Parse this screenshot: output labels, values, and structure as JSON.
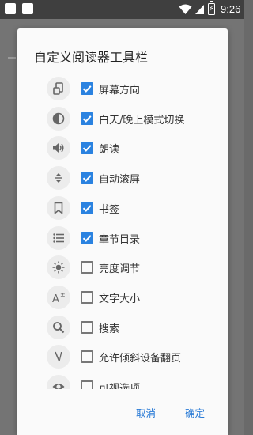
{
  "status_bar": {
    "time": "9:26",
    "battery_icon": "battery-charging-icon",
    "wifi_icon": "wifi-icon",
    "signal_icon": "signal-icon"
  },
  "dialog": {
    "title": "自定义阅读器工具栏",
    "items": [
      {
        "label": "屏幕方向",
        "checked": true,
        "icon": "screen-rotation-icon"
      },
      {
        "label": "白天/晚上模式切换",
        "checked": true,
        "icon": "day-night-icon"
      },
      {
        "label": "朗读",
        "checked": true,
        "icon": "speaker-icon"
      },
      {
        "label": "自动滚屏",
        "checked": true,
        "icon": "auto-scroll-icon"
      },
      {
        "label": "书签",
        "checked": true,
        "icon": "bookmark-icon"
      },
      {
        "label": "章节目录",
        "checked": true,
        "icon": "toc-list-icon"
      },
      {
        "label": "亮度调节",
        "checked": false,
        "icon": "brightness-icon"
      },
      {
        "label": "文字大小",
        "checked": false,
        "icon": "font-size-icon"
      },
      {
        "label": "搜索",
        "checked": false,
        "icon": "search-icon"
      },
      {
        "label": "允许倾斜设备翻页",
        "checked": false,
        "icon": "tilt-page-icon"
      },
      {
        "label": "可视选项",
        "checked": false,
        "icon": "eye-icon"
      }
    ],
    "cancel_label": "取消",
    "ok_label": "确定"
  },
  "colors": {
    "accent": "#2a82e0",
    "button_text": "#2a7bd6",
    "dim_background": "#747474"
  }
}
